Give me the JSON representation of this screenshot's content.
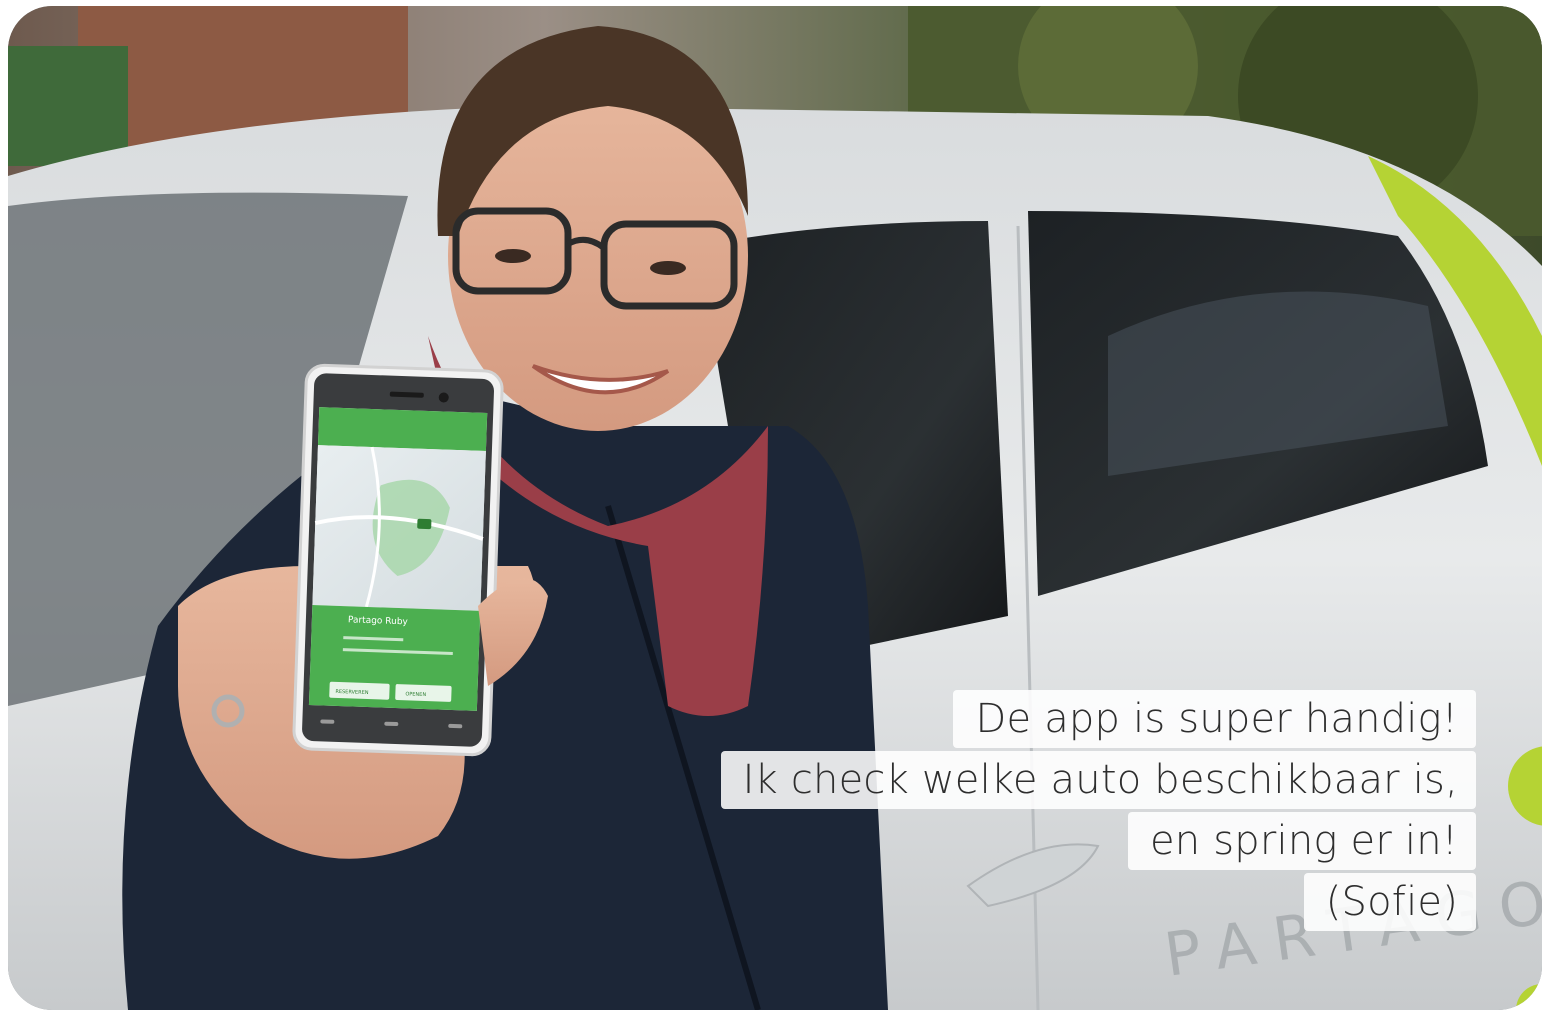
{
  "photo": {
    "caption_lines": [
      "De app is super handig!",
      "Ik check welke auto beschikbaar is,",
      "en spring er in!",
      "(Sofie)"
    ],
    "car_brand_text": "PARTAGO",
    "phone_app": {
      "title": "Partago Ruby",
      "button_left": "RESERVEREN",
      "button_right": "OPENEN"
    }
  },
  "colors": {
    "brand_green": "#4caf50",
    "accent_lime": "#b5d334",
    "car_white": "#e4e7e8",
    "jacket_navy": "#1c2637",
    "scarf_red": "#9a3e48"
  }
}
